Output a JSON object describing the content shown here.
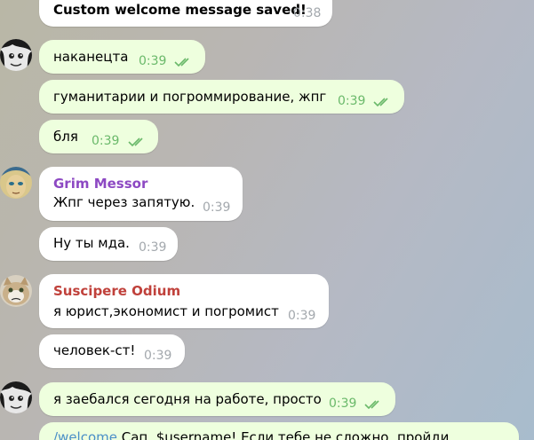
{
  "colors": {
    "incoming_bubble": "#ffffff",
    "outgoing_bubble": "#eeffde",
    "outgoing_time": "#6ab96a",
    "incoming_time": "#a3a8ad",
    "sender_grim": "#8d49c3",
    "sender_suscipere": "#c0413b",
    "link": "#4a8fc7"
  },
  "messages": [
    {
      "text": "Custom welcome message saved!",
      "time": "0:38"
    },
    {
      "text": "наканецта",
      "time": "0:39"
    },
    {
      "text": "гуманитарии и погроммирование, жпг",
      "time": "0:39"
    },
    {
      "text": "бля",
      "time": "0:39"
    },
    {
      "sender": "Grim Messor",
      "text": "Жпг через запятую.",
      "time": "0:39"
    },
    {
      "text": "Ну ты мда.",
      "time": "0:39"
    },
    {
      "sender": "Suscipere Odium",
      "text": "я юрист,экономист и погромист",
      "time": "0:39"
    },
    {
      "text": "человек-ст!",
      "time": "0:39"
    },
    {
      "text": "я заебался сегодня на работе, просто",
      "time": "0:39"
    },
    {
      "link": "/welcome",
      "text": " Сап, $username! Если тебе не сложно, пройди"
    }
  ]
}
